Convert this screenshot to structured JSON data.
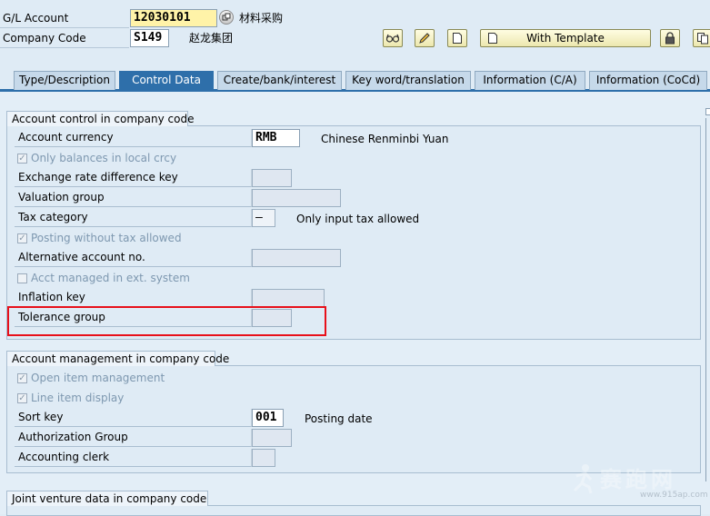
{
  "header": {
    "gl_account_label": "G/L Account",
    "gl_account_value": "12030101",
    "gl_account_desc": "材料采购",
    "company_code_label": "Company Code",
    "company_code_value": "S149",
    "company_code_desc": "赵龙集团"
  },
  "toolbar": {
    "with_template_label": "With Template",
    "icons": [
      "glasses-icon",
      "pencil-icon",
      "new-page-icon",
      "new-page-icon",
      "lock-icon",
      "copy-icon"
    ]
  },
  "tabs": [
    {
      "label": "Type/Description",
      "active": false
    },
    {
      "label": "Control Data",
      "active": true
    },
    {
      "label": "Create/bank/interest",
      "active": false
    },
    {
      "label": "Key word/translation",
      "active": false
    },
    {
      "label": "Information (C/A)",
      "active": false
    },
    {
      "label": "Information (CoCd)",
      "active": false
    }
  ],
  "account_control": {
    "title": "Account control in company code",
    "account_currency_label": "Account currency",
    "account_currency_value": "RMB",
    "account_currency_desc": "Chinese Renminbi Yuan",
    "only_balances_label": "Only balances in local crcy",
    "only_balances_checked": true,
    "exchange_rate_label": "Exchange rate difference key",
    "valuation_group_label": "Valuation group",
    "tax_category_label": "Tax category",
    "tax_category_value": "–",
    "tax_category_desc": "Only input tax allowed",
    "posting_without_tax_label": "Posting without tax allowed",
    "posting_without_tax_checked": true,
    "alt_account_label": "Alternative account no.",
    "acct_managed_label": "Acct managed in ext. system",
    "acct_managed_checked": false,
    "inflation_key_label": "Inflation key",
    "tolerance_group_label": "Tolerance group",
    "highlight_color": "#e8101a"
  },
  "account_management": {
    "title": "Account management in company code",
    "open_item_label": "Open item management",
    "open_item_checked": true,
    "line_item_label": "Line item display",
    "line_item_checked": true,
    "sort_key_label": "Sort key",
    "sort_key_value": "001",
    "sort_key_desc": "Posting date",
    "auth_group_label": "Authorization Group",
    "accounting_clerk_label": "Accounting clerk"
  },
  "joint_venture": {
    "title": "Joint venture data in company code"
  },
  "watermark": {
    "text": "赛跑网",
    "url": "www.915ap.com"
  }
}
